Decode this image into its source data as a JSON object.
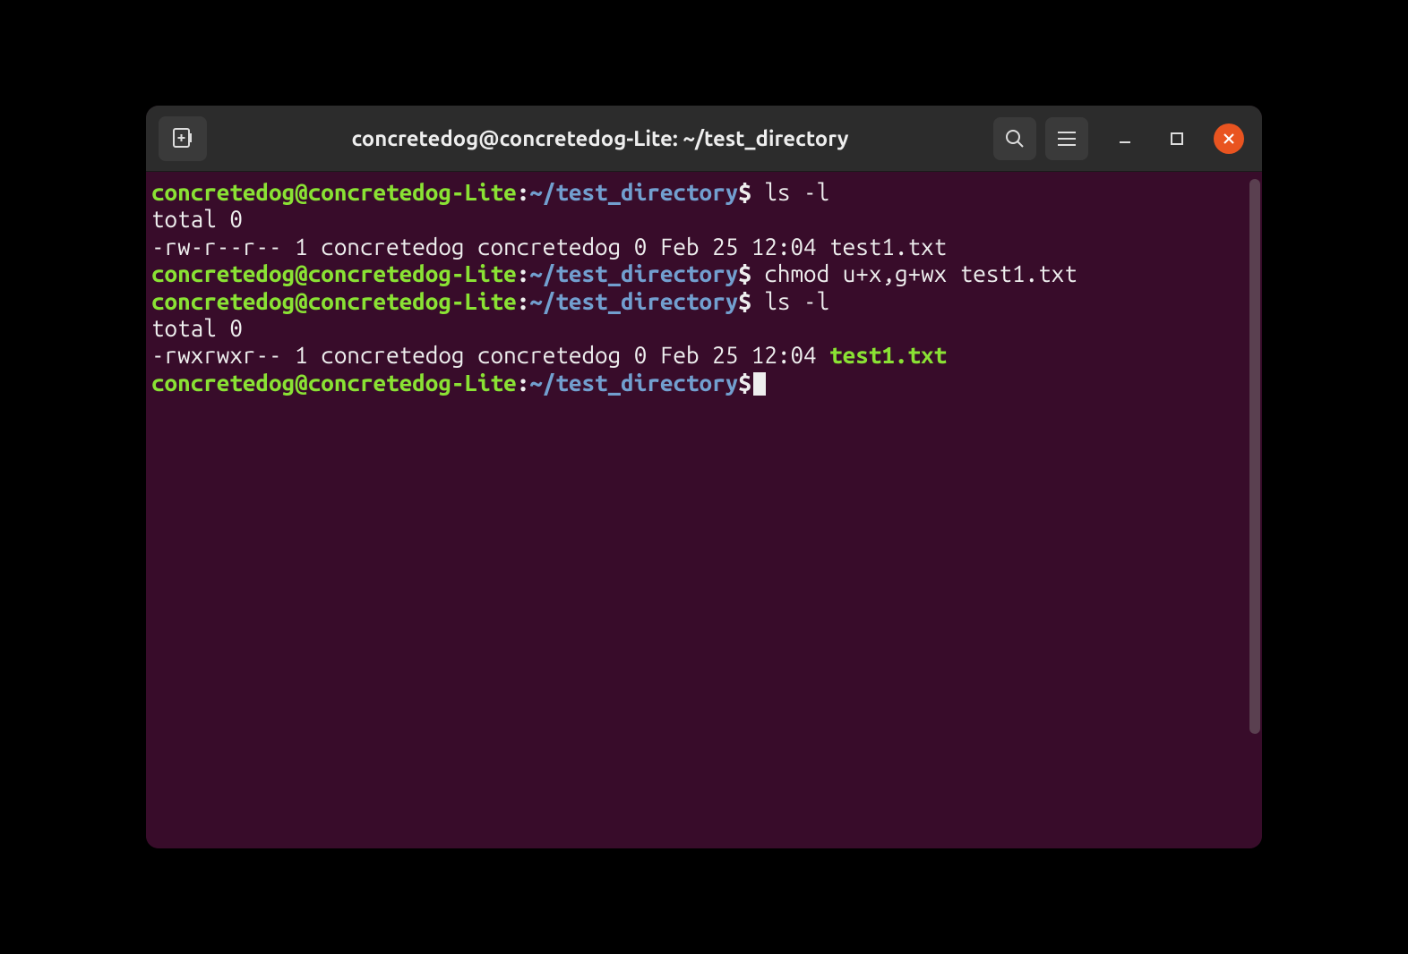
{
  "titlebar": {
    "title": "concretedog@concretedog-Lite: ~/test_directory"
  },
  "prompt": {
    "user_host": "concretedog@concretedog-Lite",
    "colon": ":",
    "path": "~/test_directory",
    "dollar": "$"
  },
  "lines": [
    {
      "type": "prompt",
      "command": "ls -l"
    },
    {
      "type": "output",
      "text": "total 0"
    },
    {
      "type": "output",
      "text": "-rw-r--r-- 1 concretedog concretedog 0 Feb 25 12:04 test1.txt"
    },
    {
      "type": "prompt",
      "command": "chmod u+x,g+wx test1.txt"
    },
    {
      "type": "prompt",
      "command": "ls -l"
    },
    {
      "type": "output",
      "text": "total 0"
    },
    {
      "type": "output_exec",
      "prefix": "-rwxrwxr-- 1 concretedog concretedog 0 Feb 25 12:04 ",
      "filename": "test1.txt"
    },
    {
      "type": "prompt_cursor",
      "command": ""
    }
  ],
  "entries": {
    "cmd0": "ls -l",
    "out1": "total 0",
    "out2": "-rw-r--r-- 1 concretedog concretedog 0 Feb 25 12:04 test1.txt",
    "cmd3": "chmod u+x,g+wx test1.txt",
    "cmd4": "ls -l",
    "out5": "total 0",
    "out6_prefix": "-rwxrwxr-- 1 concretedog concretedog 0 Feb 25 12:04 ",
    "out6_file": "test1.txt"
  },
  "colors": {
    "user": "#8ae234",
    "path": "#729fcf",
    "bg": "#380c2a",
    "close": "#e95420"
  }
}
